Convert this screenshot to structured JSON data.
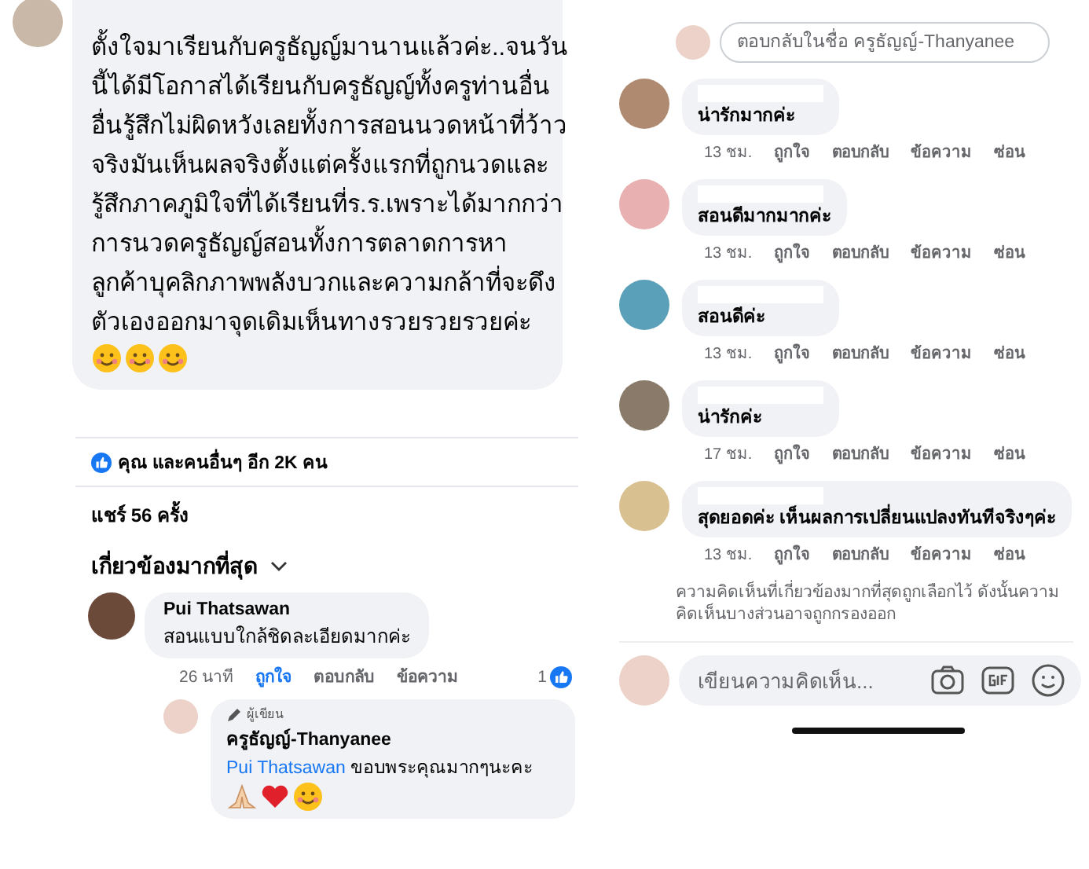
{
  "left": {
    "post_comment": {
      "lines": [
        "ตั้งใจมาเรียนกับครูธัญญ์มานานแล้วค่ะ..จนวัน",
        "นี้ได้มีโอกาสได้เรียนกับครูธัญญ์ทั้งครูท่านอื่น",
        "อื่นรู้สึกไม่ผิดหวังเลยทั้งการสอนนวดหน้าที่ว้าว",
        "จริงมันเห็นผลจริงตั้งแต่ครั้งแรกที่ถูกนวดและ",
        "รู้สึกภาคภูมิใจที่ได้เรียนที่ร.ร.เพราะได้มากกว่า",
        "การนวดครูธัญญ์สอนทั้งการตลาดการหา",
        "ลูกค้าบุคลิกภาพพลังบวกและความกล้าที่จะดึง",
        "ตัวเองออกมาจุดเดิมเห็นทางรวยรวยรวยค่ะ"
      ]
    },
    "reactions": "คุณ และคนอื่นๆ อีก 2K คน",
    "shares": "แชร์ 56 ครั้ง",
    "sort": "เกี่ยวข้องมากที่สุด",
    "comments": [
      {
        "author": "Pui Thatsawan",
        "text": "สอนแบบใกล้ชิดละเอียดมากค่ะ",
        "time": "26 นาที",
        "liked": true,
        "actions": [
          "ถูกใจ",
          "ตอบกลับ",
          "ข้อความ"
        ],
        "like_count": "1",
        "replies": [
          {
            "badge": "ผู้เขียน",
            "author": "ครูธัญญ์-Thanyanee",
            "mention": "Pui Thatsawan",
            "text": "ขอบพระคุณมากๆนะคะ"
          }
        ]
      }
    ]
  },
  "right": {
    "reply_field": {
      "placeholder": "ตอบกลับในชื่อ ครูธัญญ์-Thanyanee"
    },
    "comments": [
      {
        "text": "น่ารักมากค่ะ",
        "time": "13 ชม.",
        "liked": false,
        "actions": [
          "ถูกใจ",
          "ตอบกลับ",
          "ข้อความ",
          "ซ่อน"
        ]
      },
      {
        "text": "สอนดีมากมากค่ะ",
        "time": "13 ชม.",
        "liked": false,
        "actions": [
          "ถูกใจ",
          "ตอบกลับ",
          "ข้อความ",
          "ซ่อน"
        ]
      },
      {
        "text": "สอนดีค่ะ",
        "time": "13 ชม.",
        "liked": false,
        "actions": [
          "ถูกใจ",
          "ตอบกลับ",
          "ข้อความ",
          "ซ่อน"
        ]
      },
      {
        "text": "น่ารักค่ะ",
        "time": "17 ชม.",
        "liked": false,
        "actions": [
          "ถูกใจ",
          "ตอบกลับ",
          "ข้อความ",
          "ซ่อน"
        ]
      },
      {
        "text": "สุดยอดค่ะ เห็นผลการเปลี่ยนแปลงทันทีจริงๆค่ะ",
        "time": "13 ชม.",
        "liked": false,
        "actions": [
          "ถูกใจ",
          "ตอบกลับ",
          "ข้อความ",
          "ซ่อน"
        ]
      }
    ],
    "notice": "ความคิดเห็นที่เกี่ยวข้องมากที่สุดถูกเลือกไว้ ดังนั้นความคิดเห็นบางส่วนอาจถูกกรองออก",
    "composer": {
      "placeholder": "เขียนความคิดเห็น..."
    }
  }
}
